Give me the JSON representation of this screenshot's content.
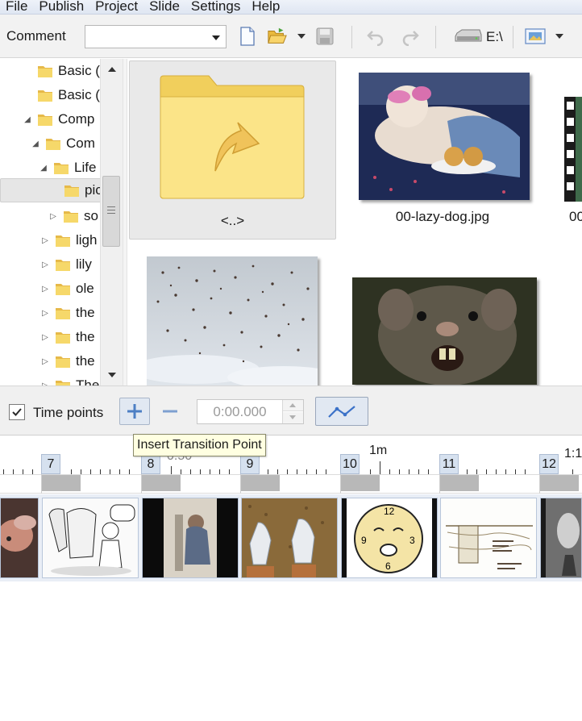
{
  "menubar": {
    "items": [
      {
        "label": "File"
      },
      {
        "label": "Publish"
      },
      {
        "label": "Project"
      },
      {
        "label": "Slide"
      },
      {
        "label": "Settings"
      },
      {
        "label": "Help"
      }
    ]
  },
  "toolbar": {
    "comment_label": "Comment",
    "comment_value": "",
    "drive_label": "E:\\",
    "icons": [
      "new-document-icon",
      "open-folder-icon",
      "save-disk-icon",
      "undo-icon",
      "redo-icon",
      "drive-icon",
      "image-view-icon"
    ]
  },
  "tree": {
    "items": [
      {
        "label": "Basic (",
        "expander": ""
      },
      {
        "label": "Basic (",
        "expander": ""
      },
      {
        "label": "Comp",
        "expander": "◢"
      },
      {
        "label": "Com",
        "expander": "◢"
      },
      {
        "label": "Life",
        "expander": "◢"
      },
      {
        "label": "pic",
        "expander": "",
        "selected": true
      },
      {
        "label": "so",
        "expander": "▷"
      },
      {
        "label": "ligh",
        "expander": "▷"
      },
      {
        "label": "lily",
        "expander": "▷"
      },
      {
        "label": "ole",
        "expander": "▷"
      },
      {
        "label": "the",
        "expander": "▷"
      },
      {
        "label": "the",
        "expander": "▷"
      },
      {
        "label": "the",
        "expander": "▷"
      },
      {
        "label": "The",
        "expander": "▷"
      }
    ]
  },
  "thumbnails": {
    "up_folder_label": "<..>",
    "items": [
      {
        "caption": "00-lazy-dog.jpg"
      },
      {
        "caption": "00"
      },
      {
        "caption": ""
      },
      {
        "caption": ""
      }
    ]
  },
  "timepoints": {
    "label": "Time points",
    "checked": true,
    "time_value": "0:00.000",
    "tooltip": "Insert Transition Point"
  },
  "timeline": {
    "ruler_labels": {
      "label_50s": "0:50",
      "label_1m": "1m",
      "label_1_1": "1:1"
    },
    "slide_numbers": [
      "7",
      "8",
      "9",
      "10",
      "11",
      "12"
    ]
  },
  "colors": {
    "menubar_bg": "#dfe6f2",
    "toolbar_bg": "#f2f2f2",
    "folder_yellow": "#f6d86a",
    "selection_blue": "#d6e1ef",
    "tooltip_bg": "#ffffe1"
  }
}
